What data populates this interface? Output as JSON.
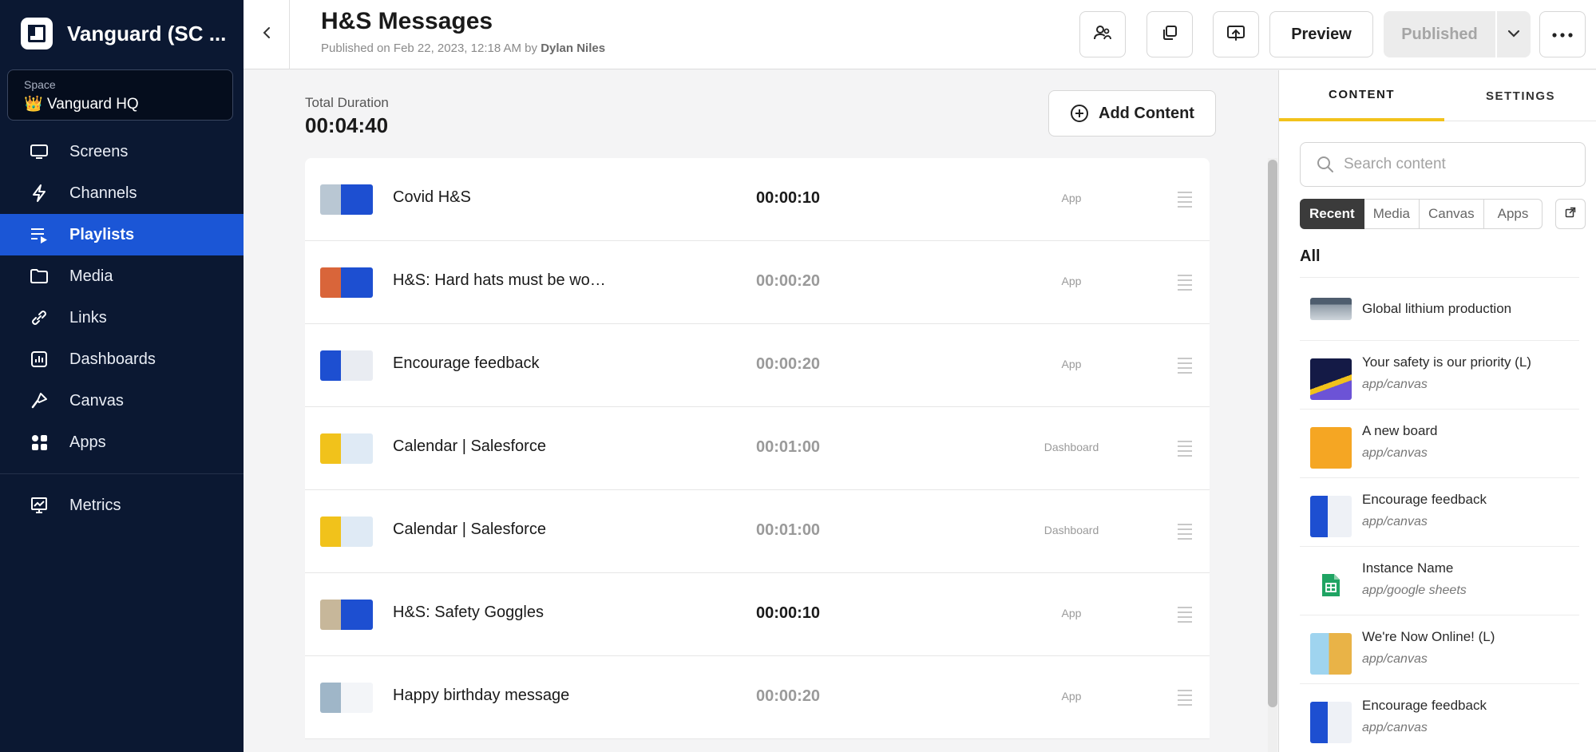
{
  "sidebar": {
    "brand": "Vanguard (SC ...",
    "space_label": "Space",
    "space_name": "👑 Vanguard HQ",
    "items": [
      {
        "label": "Screens",
        "icon": "screen-icon"
      },
      {
        "label": "Channels",
        "icon": "lightning-icon"
      },
      {
        "label": "Playlists",
        "icon": "playlist-icon",
        "active": true
      },
      {
        "label": "Media",
        "icon": "folder-icon"
      },
      {
        "label": "Links",
        "icon": "link-icon"
      },
      {
        "label": "Dashboards",
        "icon": "dashboard-icon"
      },
      {
        "label": "Canvas",
        "icon": "brush-icon"
      },
      {
        "label": "Apps",
        "icon": "apps-icon"
      }
    ],
    "metrics": {
      "label": "Metrics",
      "icon": "metrics-icon"
    }
  },
  "header": {
    "title": "H&S Messages",
    "published_prefix": "Published on Feb 22, 2023, 12:18 AM by ",
    "published_by": "Dylan Niles",
    "preview_label": "Preview",
    "published_label": "Published"
  },
  "main": {
    "total_duration_label": "Total Duration",
    "total_duration": "00:04:40",
    "add_content_label": "Add Content",
    "rows": [
      {
        "name": "Covid H&S",
        "duration": "00:00:10",
        "type": "App",
        "dark": true
      },
      {
        "name": "H&S: Hard hats must be wo…",
        "duration": "00:00:20",
        "type": "App",
        "dark": false
      },
      {
        "name": "Encourage feedback",
        "duration": "00:00:20",
        "type": "App",
        "dark": false
      },
      {
        "name": "Calendar | Salesforce",
        "duration": "00:01:00",
        "type": "Dashboard",
        "dark": false
      },
      {
        "name": "Calendar | Salesforce",
        "duration": "00:01:00",
        "type": "Dashboard",
        "dark": false
      },
      {
        "name": "H&S: Safety Goggles",
        "duration": "00:00:10",
        "type": "App",
        "dark": true
      },
      {
        "name": "Happy birthday message",
        "duration": "00:00:20",
        "type": "App",
        "dark": false
      }
    ]
  },
  "panel": {
    "tab_content": "CONTENT",
    "tab_settings": "SETTINGS",
    "search_placeholder": "Search content",
    "filters": [
      "Recent",
      "Media",
      "Canvas",
      "Apps"
    ],
    "all_label": "All",
    "items": [
      {
        "name": "Global lithium production",
        "sub": ""
      },
      {
        "name": "Your safety is our priority (L)",
        "sub": "app/canvas"
      },
      {
        "name": "A new board",
        "sub": "app/canvas"
      },
      {
        "name": "Encourage feedback",
        "sub": "app/canvas"
      },
      {
        "name": "Instance Name",
        "sub": "app/google sheets"
      },
      {
        "name": "We're Now Online! (L)",
        "sub": "app/canvas"
      },
      {
        "name": "Encourage feedback",
        "sub": "app/canvas"
      }
    ]
  },
  "colors": {
    "sidebar_bg": "#0b1832",
    "active_nav": "#1b56d6",
    "tab_accent": "#f2c21b"
  }
}
